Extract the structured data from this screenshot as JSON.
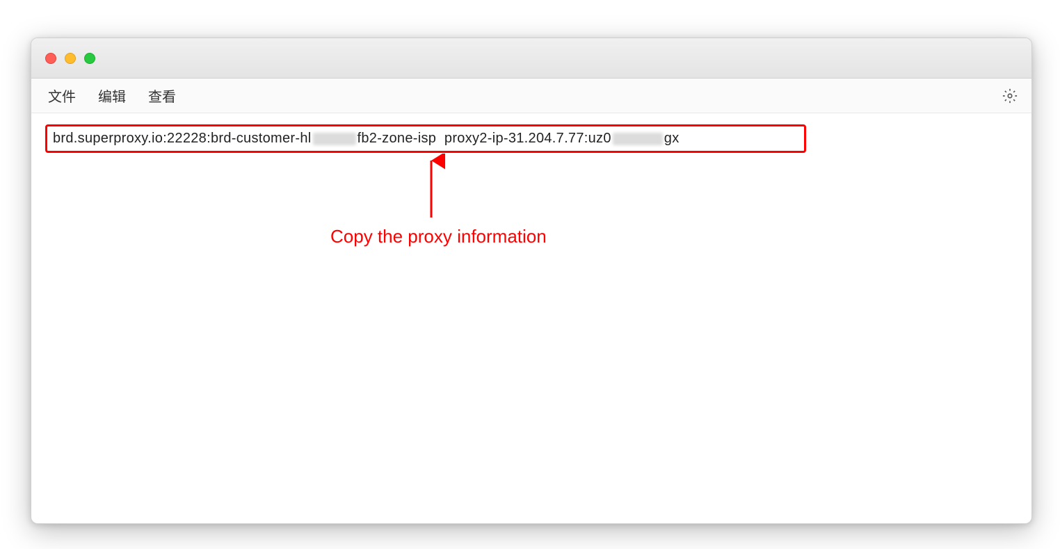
{
  "menubar": {
    "items": [
      "文件",
      "编辑",
      "查看"
    ]
  },
  "proxy": {
    "part1": "brd.superproxy.io:22228:brd-customer-hl",
    "blur1": "____",
    "part2": "fb2-zone-isp",
    "part3": "proxy2-ip-31.204.7.77:uz0",
    "blur2": "____",
    "part4": "gx"
  },
  "annotation": {
    "text": "Copy the proxy information"
  }
}
